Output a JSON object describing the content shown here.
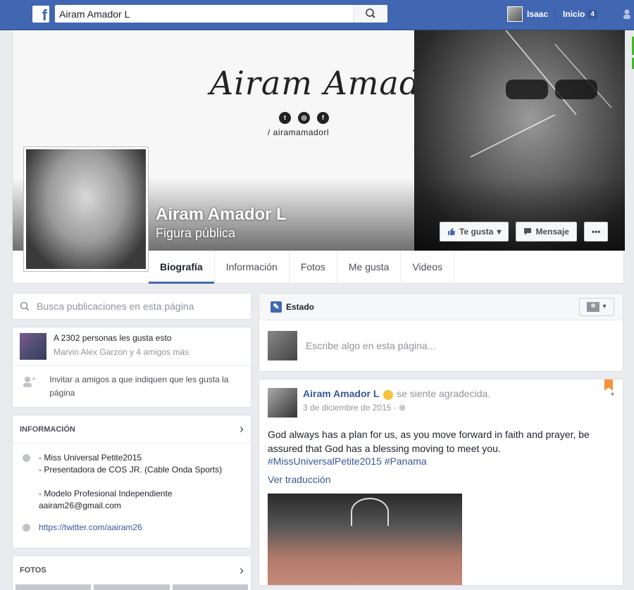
{
  "topbar": {
    "logo": "f",
    "search_value": "Airam Amador L",
    "user_name": "Isaac",
    "home_label": "Inicio",
    "home_badge": "4"
  },
  "cover": {
    "brand_script": "Airam Amador",
    "handle": "/ airamamadorl",
    "social_icons": [
      "twitter-icon",
      "instagram-icon",
      "facebook-icon"
    ]
  },
  "page": {
    "name": "Airam Amador L",
    "category": "Figura pública",
    "buttons": {
      "like": "Te gusta",
      "message": "Mensaje",
      "more": "•••"
    },
    "tabs": [
      "Biografía",
      "Información",
      "Fotos",
      "Me gusta",
      "Videos"
    ]
  },
  "left": {
    "search_placeholder": "Busca publicaciones en esta página",
    "likes_count_text": "A 2302 personas les gusta esto",
    "likes_friends_text": "Marvin Alex Garzon y 4 amigos más",
    "invite_text": "Invitar a amigos a que indiquen que les gusta la página",
    "info_title": "INFORMACIÓN",
    "info_lines": [
      "- Miss Universal Petite2015",
      "- Presentadora de COS JR. (Cable Onda Sports)",
      "",
      "- Modelo Profesional Independiente",
      "aairam26@gmail.com"
    ],
    "info_link": "https://twitter.com/aairam26",
    "photos_title": "FOTOS"
  },
  "composer": {
    "tab_label": "Estado",
    "placeholder": "Escribe algo en esta página..."
  },
  "post": {
    "author": "Airam Amador L",
    "feeling": "se siente agradecida.",
    "date": "3 de diciembre de 2015 ·",
    "text": "God always has a plan for us, as you move forward in faith and prayer, be assured that God has a blessing moving to meet you.",
    "hashtags": "#MissUniversalPetite2015 #Panama",
    "translate": "Ver traducción"
  },
  "colors": {
    "fb_blue": "#4267b2",
    "link_blue": "#365899",
    "background": "#e9ebee",
    "bookmark": "#f7923a"
  }
}
